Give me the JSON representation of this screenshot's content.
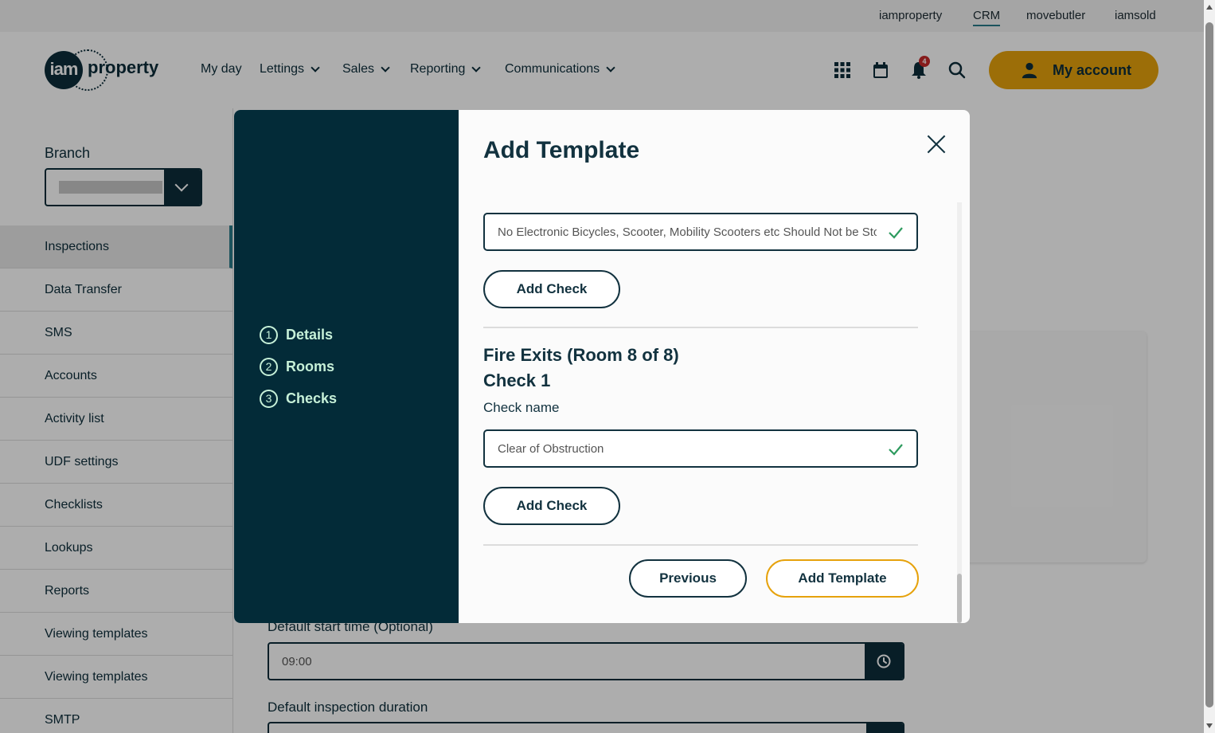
{
  "topbar": {
    "links": [
      "iamproperty",
      "CRM",
      "movebutler",
      "iamsold"
    ],
    "active": "CRM"
  },
  "header": {
    "logo_mark": "iam",
    "logo_word": "property",
    "nav": [
      {
        "label": "My day"
      },
      {
        "label": "Lettings"
      },
      {
        "label": "Sales"
      },
      {
        "label": "Reporting"
      },
      {
        "label": "Communications"
      }
    ],
    "notification_count": "4",
    "account_label": "My account",
    "accent_color": "#e6a20c"
  },
  "sidebar": {
    "branch_label": "Branch",
    "items": [
      {
        "label": "Inspections"
      },
      {
        "label": "Data Transfer"
      },
      {
        "label": "SMS"
      },
      {
        "label": "Accounts"
      },
      {
        "label": "Activity list"
      },
      {
        "label": "UDF settings"
      },
      {
        "label": "Checklists"
      },
      {
        "label": "Lookups"
      },
      {
        "label": "Reports"
      },
      {
        "label": "Viewing templates"
      },
      {
        "label": "Viewing templates"
      },
      {
        "label": "SMTP"
      }
    ]
  },
  "page": {
    "start_time_label": "Default start time (Optional)",
    "start_time_value": "09:00",
    "duration_label": "Default inspection duration"
  },
  "modal": {
    "title": "Add Template",
    "steps": [
      {
        "num": "1",
        "label": "Details"
      },
      {
        "num": "2",
        "label": "Rooms"
      },
      {
        "num": "3",
        "label": "Checks"
      }
    ],
    "prev_check_value": "No Electronic Bicycles, Scooter, Mobility Scooters etc Should Not be Stored in Communal Areas",
    "add_check_label": "Add Check",
    "room_title": "Fire Exits (Room 8 of 8)",
    "check_title": "Check 1",
    "check_name_label": "Check name",
    "check_name_value": "Clear of Obstruction",
    "previous_label": "Previous",
    "submit_label": "Add Template",
    "panel_color": "#032b38"
  }
}
